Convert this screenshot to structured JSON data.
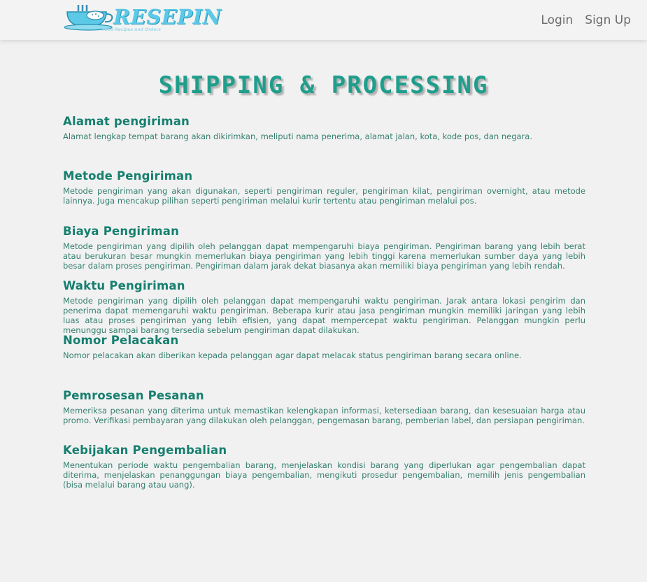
{
  "header": {
    "logo_text": "RESEPIN",
    "logo_tagline": "Food Recipes and Orders",
    "nav": [
      {
        "label": "Login"
      },
      {
        "label": "Sign Up"
      }
    ]
  },
  "main": {
    "title": "SHIPPING & PROCESSING",
    "sections": [
      {
        "heading": "Alamat pengiriman",
        "body": "Alamat lengkap tempat barang akan dikirimkan, meliputi nama penerima, alamat jalan, kota, kode pos, dan negara."
      },
      {
        "heading": "Metode Pengiriman",
        "body": "Metode pengiriman yang akan digunakan, seperti pengiriman reguler, pengiriman kilat, pengiriman overnight, atau metode lainnya. Juga mencakup pilihan seperti pengiriman melalui kurir tertentu atau pengiriman melalui pos."
      },
      {
        "heading": "Biaya Pengiriman",
        "body": "Metode pengiriman yang dipilih oleh pelanggan dapat mempengaruhi biaya pengiriman. Pengiriman barang yang lebih berat atau berukuran besar mungkin memerlukan biaya pengiriman yang lebih tinggi karena memerlukan sumber daya yang lebih besar dalam proses pengiriman. Pengiriman dalam jarak dekat biasanya akan memiliki biaya pengiriman yang lebih rendah."
      },
      {
        "heading": "Waktu Pengiriman",
        "body": "Metode pengiriman yang dipilih oleh pelanggan dapat mempengaruhi waktu pengiriman. Jarak antara lokasi pengirim dan penerima dapat memengaruhi waktu pengiriman. Beberapa kurir atau jasa pengiriman mungkin memiliki jaringan yang lebih luas atau proses pengiriman yang lebih efisien, yang dapat mempercepat waktu pengiriman. Pelanggan mungkin perlu menunggu sampai barang tersedia sebelum pengiriman dapat dilakukan."
      },
      {
        "heading": "Nomor Pelacakan",
        "body": "Nomor pelacakan akan diberikan kepada pelanggan agar dapat melacak status pengiriman barang secara online."
      },
      {
        "heading": "Pemrosesan Pesanan",
        "body": "Memeriksa pesanan yang diterima untuk memastikan kelengkapan informasi, ketersediaan barang, dan kesesuaian harga atau promo. Verifikasi pembayaran yang dilakukan oleh pelanggan, pengemasan barang, pemberian label, dan persiapan pengiriman."
      },
      {
        "heading": "Kebijakan Pengembalian",
        "body": "Menentukan periode waktu pengembalian barang, menjelaskan kondisi barang yang diperlukan agar pengembalian dapat diterima, menjelaskan penanggungan biaya pengembalian, mengikuti prosedur pengembalian, memilih jenis pengembalian (bisa melalui barang atau uang)."
      }
    ]
  },
  "colors": {
    "accent": "#1f9e8c",
    "heading": "#167f6f",
    "body_text": "#35806f",
    "logo": "#5cc9e6",
    "background": "#f1f1f1"
  }
}
